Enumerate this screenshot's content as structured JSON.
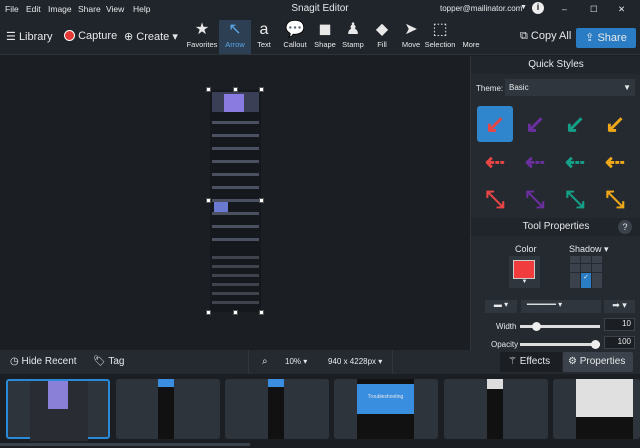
{
  "menu": [
    "File",
    "Edit",
    "Image",
    "Share",
    "View",
    "Help"
  ],
  "title": "Snagit Editor",
  "account": "topper@mailinator.com",
  "toolbar": {
    "library": "Library",
    "capture": "Capture",
    "create": "Create",
    "copy_all": "Copy All",
    "share": "Share",
    "tools": [
      {
        "label": "Favorites",
        "icon": "★"
      },
      {
        "label": "Arrow",
        "icon": "↖"
      },
      {
        "label": "Text",
        "icon": "a"
      },
      {
        "label": "Callout",
        "icon": "💬"
      },
      {
        "label": "Shape",
        "icon": "◼"
      },
      {
        "label": "Stamp",
        "icon": "♟"
      },
      {
        "label": "Fill",
        "icon": "◆"
      },
      {
        "label": "Move",
        "icon": "➤"
      },
      {
        "label": "Selection",
        "icon": "⬚"
      },
      {
        "label": "More",
        "icon": ""
      }
    ],
    "active_tool": "Arrow"
  },
  "quick_styles": {
    "title": "Quick Styles",
    "theme_label": "Theme:",
    "theme_value": "Basic",
    "colors": [
      "#e84545",
      "#6b2fa0",
      "#14a088",
      "#f0a818"
    ]
  },
  "tool_properties": {
    "title": "Tool Properties",
    "help": "?",
    "color_label": "Color",
    "color_value": "#f03c3c",
    "shadow_label": "Shadow",
    "width_label": "Width",
    "width_value": "10",
    "opacity_label": "Opacity",
    "opacity_value": "100"
  },
  "bottom": {
    "hide_recent": "Hide Recent",
    "tag": "Tag",
    "zoom": "10%",
    "dimensions": "940 x 4228px",
    "effects": "Effects",
    "properties": "Properties"
  },
  "film": {
    "thumb4_text": "Troubleshooting"
  }
}
